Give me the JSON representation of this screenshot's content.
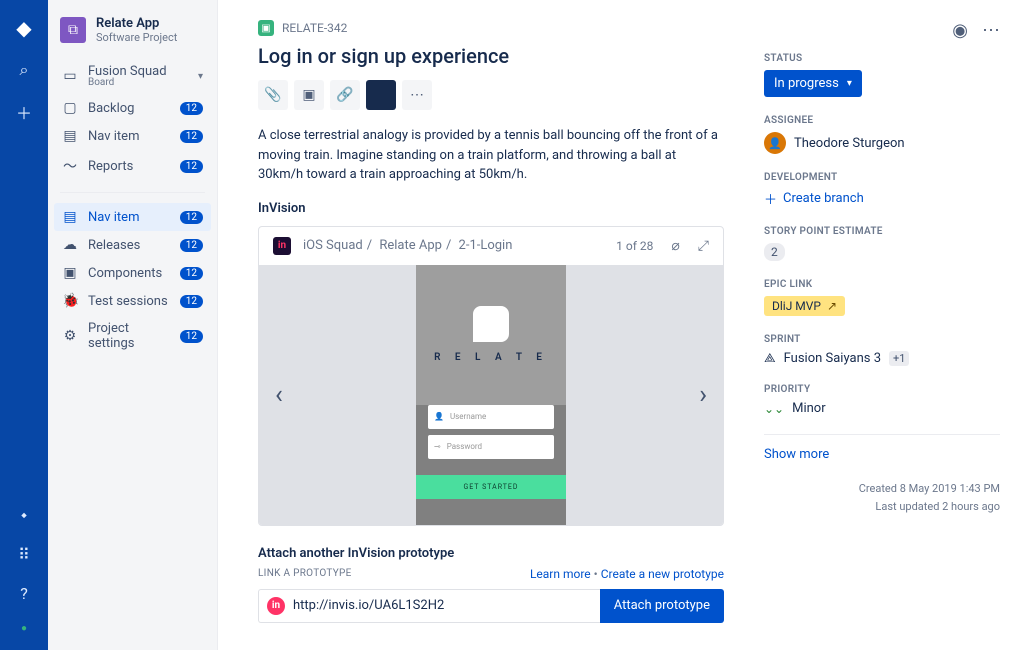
{
  "project": {
    "name": "Relate App",
    "type": "Software Project",
    "avatar_letter": "⧉"
  },
  "sidebar": {
    "groups": [
      [
        {
          "label": "Fusion Squad",
          "sub": "Board",
          "caret": true
        },
        {
          "label": "Backlog",
          "badge": "12"
        },
        {
          "label": "Nav item",
          "badge": "12"
        },
        {
          "label": "Reports",
          "badge": "12"
        }
      ],
      [
        {
          "label": "Nav item",
          "badge": "12",
          "active": true
        },
        {
          "label": "Releases",
          "badge": "12"
        },
        {
          "label": "Components",
          "badge": "12"
        },
        {
          "label": "Test sessions",
          "badge": "12"
        },
        {
          "label": "Project settings",
          "badge": "12"
        }
      ]
    ]
  },
  "issue": {
    "key": "RELATE-342",
    "title": "Log in or sign up experience",
    "description": "A close terrestrial analogy is provided by a tennis ball bouncing off the front of a moving train. Imagine standing on a train platform, and throwing a ball at 30km/h toward a train approaching at 50km/h.",
    "invision_label": "InVision"
  },
  "invision": {
    "breadcrumb": {
      "a": "iOS Squad",
      "b": "Relate App",
      "c": "2-1-Login"
    },
    "counter": "1 of 28",
    "screen": {
      "brand": "R E L A T E",
      "user_ph": "Username",
      "pass_ph": "Password",
      "cta": "GET STARTED"
    }
  },
  "attach": {
    "title": "Attach another InVision prototype",
    "sub": "LINK A PROTOTYPE",
    "learn": "Learn more",
    "create": "Create a new prototype",
    "url": "http://invis.io/UA6L1S2H2",
    "button": "Attach prototype"
  },
  "details": {
    "status_label": "STATUS",
    "status_value": "In progress",
    "assignee_label": "ASSIGNEE",
    "assignee_value": "Theodore Sturgeon",
    "dev_label": "DEVELOPMENT",
    "dev_action": "Create branch",
    "sp_label": "STORY POINT ESTIMATE",
    "sp_value": "2",
    "epic_label": "EPIC LINK",
    "epic_value": "DliJ MVP",
    "sprint_label": "SPRINT",
    "sprint_value": "Fusion Saiyans 3",
    "sprint_extra": "+1",
    "priority_label": "PRIORITY",
    "priority_value": "Minor",
    "show_more": "Show more",
    "created": "Created 8 May 2019 1:43 PM",
    "updated": "Last updated 2 hours ago"
  }
}
